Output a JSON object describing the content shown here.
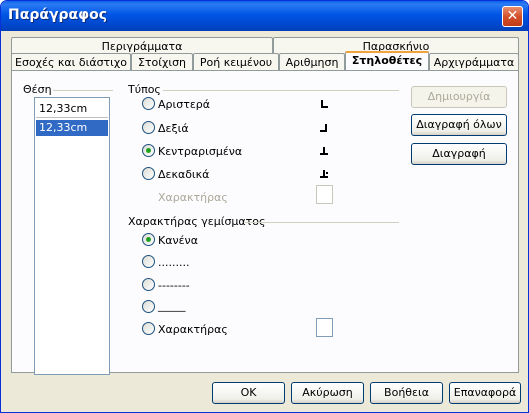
{
  "window": {
    "title": "Παράγραφος",
    "close_glyph": "✕"
  },
  "tabs_row1": [
    "Περιγράμματα",
    "Παρασκήνιο"
  ],
  "tabs_row2": [
    "Εσοχές και διάστιχο",
    "Στοίχιση",
    "Ροή κειμένου",
    "Αριθμηση",
    "Στηλοθέτες",
    "Αρχιγράμματα"
  ],
  "active_tab": "Στηλοθέτες",
  "position": {
    "label": "Θέση",
    "input_value": "12,33cm",
    "items": [
      "12,33cm"
    ]
  },
  "type": {
    "label": "Τύπος",
    "options": [
      "Αριστερά",
      "Δεξιά",
      "Κεντραρισμένα",
      "Δεκαδικά"
    ],
    "selected": "Κεντραρισμένα",
    "character_label": "Χαρακτήρας"
  },
  "fill": {
    "label": "Χαρακτήρας γεμίσματος",
    "options": [
      "Κανένα",
      ".........",
      "--------",
      "_____",
      "Χαρακτήρας"
    ],
    "selected": "Κανένα"
  },
  "side_buttons": {
    "new": "Δημιουργία",
    "delete_all": "Διαγραφή όλων",
    "delete": "Διαγραφή"
  },
  "footer": {
    "ok": "OK",
    "cancel": "Ακύρωση",
    "help": "Βοήθεια",
    "reset": "Επαναφορά"
  }
}
